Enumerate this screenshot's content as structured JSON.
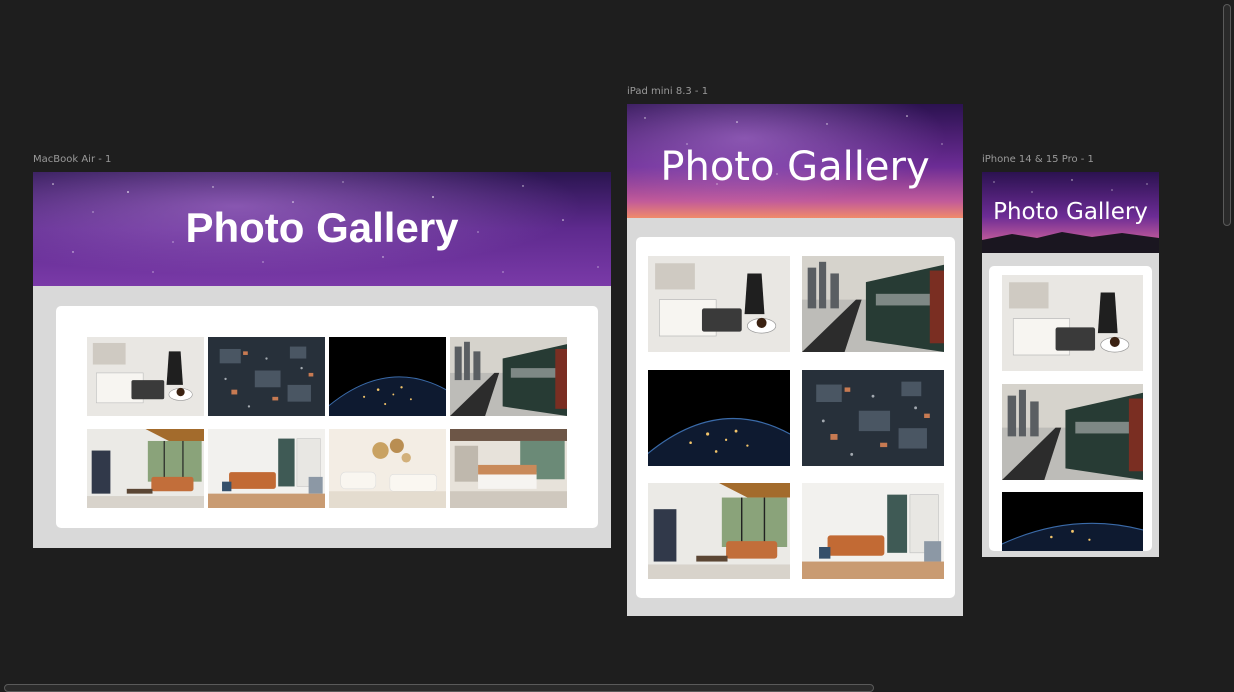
{
  "frames": {
    "macbook": {
      "label": "MacBook Air - 1",
      "title": "Photo Gallery"
    },
    "ipad": {
      "label": "iPad mini 8.3 - 1",
      "title": "Photo Gallery"
    },
    "iphone": {
      "label": "iPhone 14 & 15 Pro - 1",
      "title": "Photo Gallery"
    }
  },
  "photos": [
    {
      "name": "workspace-coffee-photo"
    },
    {
      "name": "circuit-board-photo"
    },
    {
      "name": "earth-night-photo"
    },
    {
      "name": "city-railway-photo"
    },
    {
      "name": "living-room-window-photo"
    },
    {
      "name": "living-room-orange-sofa-photo"
    },
    {
      "name": "living-room-beige-photo"
    },
    {
      "name": "bedroom-photo"
    }
  ],
  "colors": {
    "canvas": "#1e1e1e",
    "frame_bg": "#d9d9d9",
    "hero_purple": "#5a1d8c",
    "card": "#ffffff"
  }
}
